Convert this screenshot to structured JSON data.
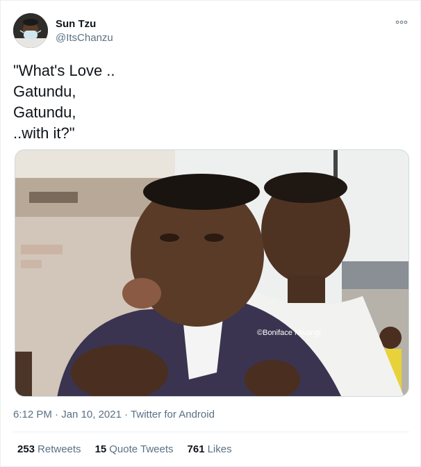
{
  "author": {
    "display_name": "Sun Tzu",
    "handle": "@ItsChanzu",
    "avatar_icon": "profile-avatar"
  },
  "tweet": {
    "text": "\"What's Love ..\nGatundu,\nGatundu,\n..with it?\"",
    "media_watermark": "©Boniface Mwangi"
  },
  "meta": {
    "time": "6:12 PM",
    "separator": "·",
    "date": "Jan 10, 2021",
    "source": "Twitter for Android"
  },
  "stats": {
    "retweets_count": "253",
    "retweets_label": "Retweets",
    "quotes_count": "15",
    "quotes_label": "Quote Tweets",
    "likes_count": "761",
    "likes_label": "Likes"
  },
  "colors": {
    "text_primary": "#0f1419",
    "text_secondary": "#5b7083",
    "border": "#ebeef0"
  }
}
